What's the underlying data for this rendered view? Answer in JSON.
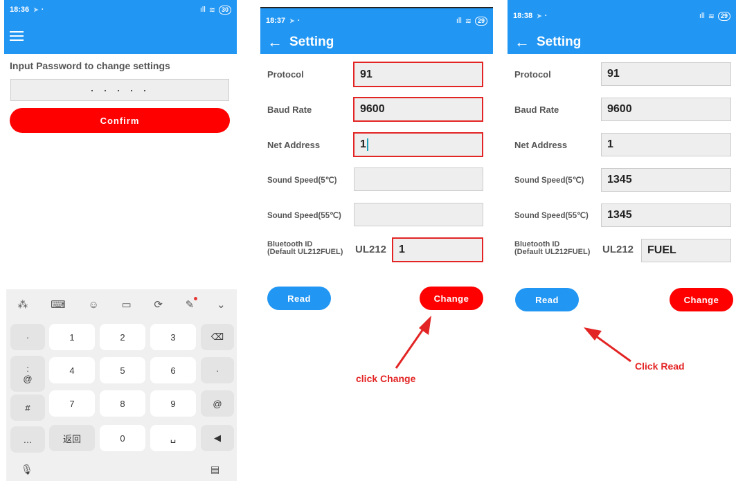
{
  "colors": {
    "blue": "#2196f3",
    "red": "#ff0000",
    "highlight": "#e32424"
  },
  "phone1": {
    "status": {
      "time": "18:36",
      "signal": "ᵢₗ",
      "battery": "30"
    },
    "menu_icon": "hamburger-icon",
    "prompt": "Input Password to change settings",
    "password_value": "· · · · ·",
    "confirm_label": "Confirm",
    "keyboard": {
      "toolbar": [
        "88",
        "⌨",
        "☺",
        "▭",
        "⟳",
        "🔧",
        "⌄"
      ],
      "side_keys": [
        "·",
        ":",
        "@",
        "#",
        "…"
      ],
      "keys": [
        [
          "1",
          "2",
          "3",
          "⌫"
        ],
        [
          "4",
          "5",
          "6",
          "·"
        ],
        [
          "7",
          "8",
          "9",
          "@"
        ],
        [
          "返回",
          "0",
          "␣",
          "◀"
        ]
      ]
    }
  },
  "phone2": {
    "status": {
      "time": "18:37",
      "battery": "29"
    },
    "title": "Setting",
    "fields": [
      {
        "label": "Protocol",
        "value": "91"
      },
      {
        "label": "Baud Rate",
        "value": "9600"
      },
      {
        "label": "Net Address",
        "value": "1"
      },
      {
        "label": "Sound Speed(5℃)",
        "value": ""
      },
      {
        "label": "Sound Speed(55℃)",
        "value": ""
      }
    ],
    "bluetooth": {
      "label_line1": "Bluetooth ID",
      "label_line2": "(Default UL212FUEL)",
      "prefix": "UL212",
      "value": "1"
    },
    "read_label": "Read",
    "change_label": "Change",
    "annotation": "click Change"
  },
  "phone3": {
    "status": {
      "time": "18:38",
      "battery": "29"
    },
    "title": "Setting",
    "fields": [
      {
        "label": "Protocol",
        "value": "91"
      },
      {
        "label": "Baud Rate",
        "value": "9600"
      },
      {
        "label": "Net Address",
        "value": "1"
      },
      {
        "label": "Sound Speed(5℃)",
        "value": "1345"
      },
      {
        "label": "Sound Speed(55℃)",
        "value": "1345"
      }
    ],
    "bluetooth": {
      "label_line1": "Bluetooth ID",
      "label_line2": "(Default UL212FUEL)",
      "prefix": "UL212",
      "value": "FUEL"
    },
    "read_label": "Read",
    "change_label": "Change",
    "annotation": "Click Read"
  }
}
